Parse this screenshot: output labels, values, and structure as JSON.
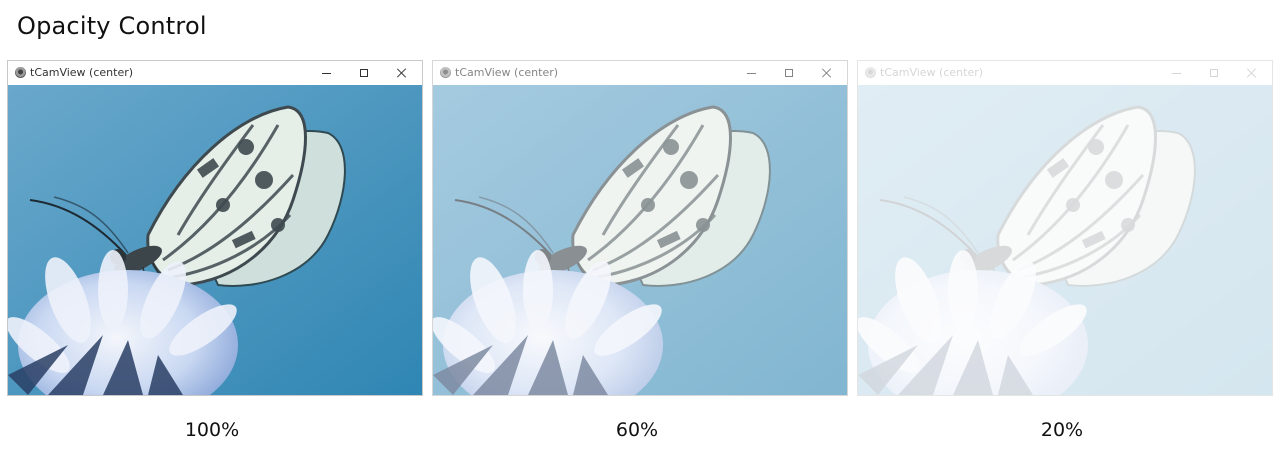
{
  "page": {
    "title": "Opacity Control"
  },
  "windows": [
    {
      "title": "tCamView (center)",
      "opacity_label": "100%",
      "opacity": 1.0
    },
    {
      "title": "tCamView (center)",
      "opacity_label": "60%",
      "opacity": 0.6
    },
    {
      "title": "tCamView (center)",
      "opacity_label": "20%",
      "opacity": 0.2
    }
  ],
  "colors": {
    "sky_top": "#6aa8cc",
    "sky_bottom": "#2f86b3",
    "wing_light": "#e6eee8",
    "wing_dark": "#3e4a4f",
    "flower": "#c9d8f2",
    "flower_dark": "#2a3f66"
  },
  "icons": {
    "app": "webcam-icon",
    "minimize": "minimize-icon",
    "maximize": "maximize-icon",
    "close": "close-icon"
  }
}
